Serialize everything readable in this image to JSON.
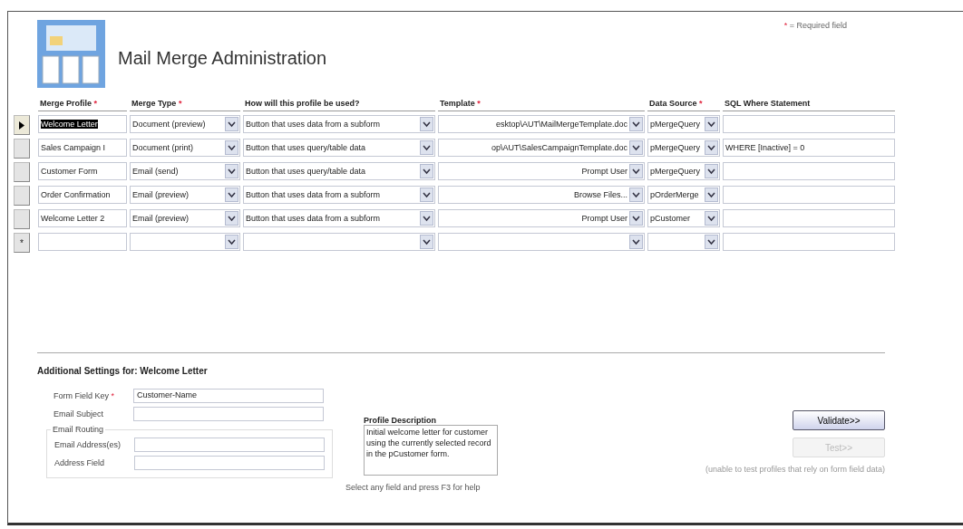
{
  "title": "Mail Merge Administration",
  "legend": {
    "mark": "*",
    "text": "= Required field"
  },
  "columns": [
    {
      "label": "Merge Profile",
      "required_mark": "*"
    },
    {
      "label": "Merge Type",
      "required_mark": "*"
    },
    {
      "label": "How will this profile be used?"
    },
    {
      "label": "Template",
      "required_mark": "*"
    },
    {
      "label": "Data Source",
      "required_mark": "*"
    },
    {
      "label": "SQL Where Statement"
    }
  ],
  "rows": [
    {
      "selected": true,
      "profile": "Welcome Letter",
      "type": "Document (preview)",
      "usage": "Button that uses data from a subform",
      "template": "esktop\\AUT\\MailMergeTemplate.doc",
      "source": "pMergeQuery"
    },
    {
      "selected": false,
      "profile": "Sales Campaign I",
      "type": "Document (print)",
      "usage": "Button that uses query/table data",
      "template": "op\\AUT\\SalesCampaignTemplate.doc",
      "source": "pMergeQuery",
      "sql": "WHERE [Inactive] = 0"
    },
    {
      "selected": false,
      "profile": "Customer Form",
      "type": "Email (send)",
      "usage": "Button that uses query/table data",
      "template": "Prompt User",
      "source": "pMergeQuery"
    },
    {
      "selected": false,
      "profile": "Order Confirmation",
      "type": "Email (preview)",
      "usage": "Button that uses data from a subform",
      "template": "Browse Files...",
      "source": "pOrderMerge"
    },
    {
      "selected": false,
      "profile": "Welcome Letter 2",
      "type": "Email (preview)",
      "usage": "Button that uses data from a subform",
      "template": "Prompt User",
      "source": "pCustomer"
    },
    {
      "selected": false,
      "new_marker": "*"
    }
  ],
  "settings": {
    "title": "Additional Settings for: Welcome Letter",
    "fields": [
      {
        "label": "Form Field Key",
        "required_mark": "*",
        "value": "Customer-Name"
      },
      {
        "label": "Email Subject"
      }
    ],
    "routing": {
      "legend": "Email Routing",
      "fields": [
        {
          "label": "Email Address(es)"
        },
        {
          "label": "Address Field"
        }
      ]
    },
    "description": {
      "label": "Profile Description",
      "text": "Initial welcome letter for customer using the currently selected record in the pCustomer form."
    },
    "help": "Select any field and press F3 for help"
  },
  "buttons": [
    {
      "label": "Validate>>",
      "disabled": false
    },
    {
      "label": "Test>>",
      "disabled": true
    }
  ],
  "note": "(unable to test profiles that rely on form field data)"
}
